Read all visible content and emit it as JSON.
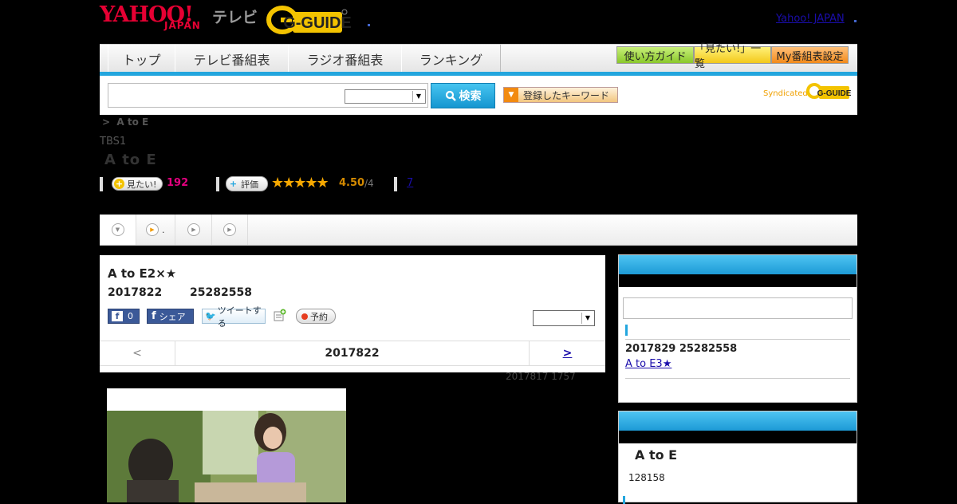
{
  "header": {
    "logo_yahoo": "YAHOO!",
    "logo_japan": "JAPAN",
    "logo_tv": "テレビ",
    "logo_gguide": "G-GUIDE",
    "yahoo_japan_link": "Yahoo! JAPAN"
  },
  "nav": {
    "tabs": [
      "トップ",
      "テレビ番組表",
      "ラジオ番組表",
      "ランキング"
    ],
    "guide_buttons": [
      "使い方ガイド",
      "「見たい!」一覧",
      "My番組表設定"
    ]
  },
  "search": {
    "button_label": "検索",
    "keyword_button": "登録したキーワード",
    "syndicated": "Syndicated",
    "syndicated_logo": "G-GUIDE"
  },
  "program": {
    "breadcrumb_sep": ">",
    "breadcrumb_title": "A to E",
    "channel": "TBS1",
    "title": "A to E",
    "want_label": "見たい!",
    "want_count": "192",
    "eval_label": "評価",
    "stars": "★★★★★",
    "rating": "4.50",
    "rating_count": "/4",
    "link_count": "7"
  },
  "tabs": {
    "item2_label": "."
  },
  "episode": {
    "title": "A to E2×★",
    "date": "2017822",
    "time": "25282558",
    "fb_count": "0",
    "share_label": "シェア",
    "tweet_label": "ツイートする",
    "reserve_label": "予約",
    "pager_prev": "<",
    "pager_date": "2017822",
    "pager_next": ">",
    "updated": "2017817  1757"
  },
  "sidebar": {
    "next_date": "2017829  25282558",
    "next_link": "A to E3★",
    "box2_title": "A to E",
    "box2_number": "128158"
  },
  "colors": {
    "accent_blue": "#23a6de",
    "yahoo_red": "#e60033",
    "want_pink": "#e4007f",
    "star_orange": "#f6a800"
  }
}
